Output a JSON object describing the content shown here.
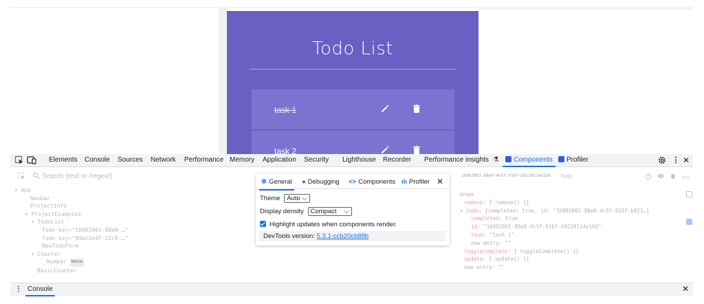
{
  "todo_app": {
    "title": "Todo List",
    "items": [
      {
        "text": "task 1",
        "completed": true
      },
      {
        "text": "task 2",
        "completed": false
      }
    ]
  },
  "devtools": {
    "tabs": [
      {
        "label": "Elements"
      },
      {
        "label": "Console"
      },
      {
        "label": "Sources"
      },
      {
        "label": "Network"
      },
      {
        "label": "Performance"
      },
      {
        "label": "Memory"
      },
      {
        "label": "Application"
      },
      {
        "label": "Security"
      },
      {
        "label": "Lighthouse"
      },
      {
        "label": "Recorder"
      },
      {
        "label": "Performance insights"
      },
      {
        "label": "Components"
      },
      {
        "label": "Profiler"
      }
    ],
    "active_tab": "Components",
    "accent": "#1a73e8"
  },
  "components": {
    "search_placeholder": "Search (text or /regex/)",
    "tree": [
      {
        "label": "App"
      },
      {
        "label": "Navbar"
      },
      {
        "label": "ProjectInfo"
      },
      {
        "label": "ProjectExamples"
      },
      {
        "label": "TodoList"
      },
      {
        "label": "Todo",
        "key_attr": "key=",
        "key_value": "\"1b902001-88e0-…\""
      },
      {
        "label": "Todo",
        "key_attr": "key=",
        "key_value": "\"9dac2e4f-22c9-…\""
      },
      {
        "label": "NewTodoForm"
      },
      {
        "label": "Counter"
      },
      {
        "label": "_Number",
        "badge": "Memo"
      },
      {
        "label": "BasicCounter"
      }
    ],
    "selected": {
      "key": "1b902001-88e0-4c5f-916f-b9239114e168",
      "name": "Todo",
      "props_title": "props",
      "props": [
        {
          "key": "remove",
          "value": "ƒ remove() {}"
        },
        {
          "key": "todo",
          "value": "{completed: true, id: \"1b902001-88e0-4c5f-916f-b923…}"
        },
        {
          "key": "completed",
          "value": "true"
        },
        {
          "key": "id",
          "value": "\"1b902001-88e0-4c5f-916f-b9239114e168\""
        },
        {
          "key": "task",
          "value": "\"task 1\""
        },
        {
          "key": "new entry",
          "value": "\"\""
        },
        {
          "key": "toggleComplete",
          "value": "ƒ toggleComplete() {}"
        },
        {
          "key": "update",
          "value": "ƒ update() {}"
        },
        {
          "key": "new entry",
          "value": "\"\""
        }
      ]
    }
  },
  "settings_popup": {
    "tabs": [
      {
        "label": "General"
      },
      {
        "label": "Debugging"
      },
      {
        "label": "Components"
      },
      {
        "label": "Profiler"
      }
    ],
    "theme_label": "Theme",
    "theme_value": "Auto",
    "density_label": "Display density",
    "density_value": "Compact",
    "highlight_label": "Highlight updates when components render.",
    "highlight_checked": true,
    "version_label": "DevTools version:",
    "version_value": "5.3.1-ccb20cb88b"
  },
  "drawer": {
    "tab": "Console"
  }
}
